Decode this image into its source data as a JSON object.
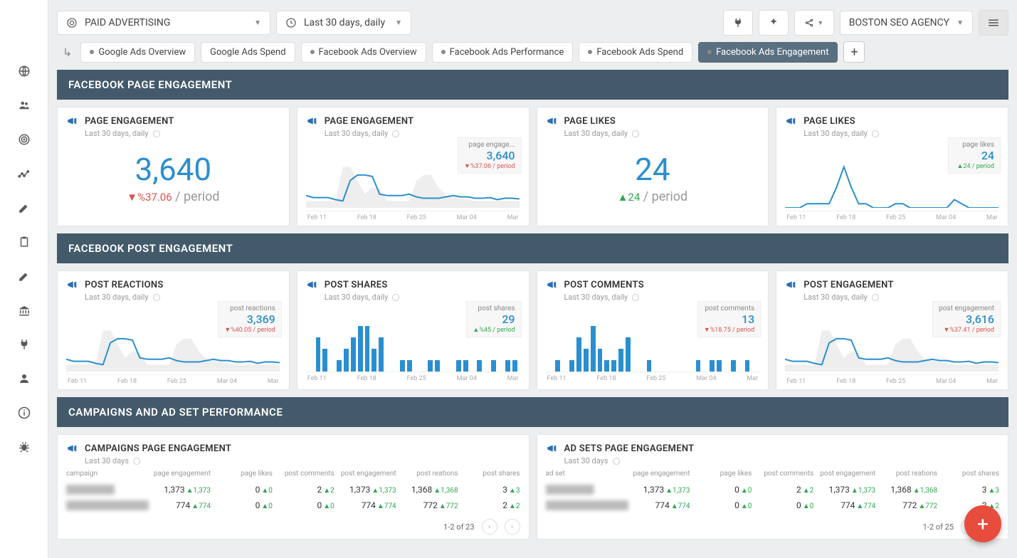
{
  "topbar": {
    "report_name": "PAID ADVERTISING",
    "date_range": "Last 30 days, daily",
    "client_name": "BOSTON SEO AGENCY"
  },
  "tabs": [
    {
      "label": "Google Ads Overview",
      "dot": true
    },
    {
      "label": "Google Ads Spend",
      "dot": false
    },
    {
      "label": "Facebook Ads Overview",
      "dot": true
    },
    {
      "label": "Facebook Ads Performance",
      "dot": true
    },
    {
      "label": "Facebook Ads Spend",
      "dot": true
    },
    {
      "label": "Facebook Ads Engagement",
      "dot": true,
      "active": true
    }
  ],
  "sections": {
    "s1": "FACEBOOK PAGE ENGAGEMENT",
    "s2": "FACEBOOK POST ENGAGEMENT",
    "s3": "CAMPAIGNS AND AD SET PERFORMANCE"
  },
  "xaxis": [
    "Feb 11",
    "Feb 18",
    "Feb 25",
    "Mar 04",
    "Mar"
  ],
  "page_engagement_big": {
    "title": "PAGE ENGAGEMENT",
    "sub": "Last 30 days, daily",
    "value": "3,640",
    "delta": "▼%37.06",
    "period": "/ period"
  },
  "page_engagement_chart": {
    "title": "PAGE ENGAGEMENT",
    "sub": "Last 30 days, daily",
    "box_label": "page engage...",
    "box_value": "3,640",
    "box_delta": "▼%37.06 / period"
  },
  "page_likes_big": {
    "title": "PAGE LIKES",
    "sub": "Last 30 days, daily",
    "value": "24",
    "delta": "▲24",
    "period": "/ period"
  },
  "page_likes_chart": {
    "title": "PAGE LIKES",
    "sub": "Last 30 days, daily",
    "box_label": "page likes",
    "box_value": "24",
    "box_delta": "▲24 / period"
  },
  "post_reactions": {
    "title": "POST REACTIONS",
    "sub": "Last 30 days, daily",
    "box_label": "post reactions",
    "box_value": "3,369",
    "box_delta": "▼%40.05 / period"
  },
  "post_shares": {
    "title": "POST SHARES",
    "sub": "Last 30 days, daily",
    "box_label": "post shares",
    "box_value": "29",
    "box_delta": "▲%45 / period"
  },
  "post_comments": {
    "title": "POST COMMENTS",
    "sub": "Last 30 days, daily",
    "box_label": "post comments",
    "box_value": "13",
    "box_delta": "▼%18.75 / period"
  },
  "post_engagement": {
    "title": "POST ENGAGEMENT",
    "sub": "Last 30 days, daily",
    "box_label": "post engagement",
    "box_value": "3,616",
    "box_delta": "▼%37.41 / period"
  },
  "chart_data": [
    {
      "id": "page_engagement_chart",
      "type": "line",
      "xlabel": "",
      "ylabel": "",
      "x_ticks": [
        "Feb 11",
        "Feb 18",
        "Feb 25",
        "Mar 04",
        "Mar"
      ],
      "series": [
        {
          "name": "current",
          "values": [
            18,
            15,
            15,
            15,
            12,
            10,
            40,
            48,
            48,
            46,
            20,
            18,
            18,
            18,
            20,
            16,
            14,
            14,
            14,
            16,
            18,
            16,
            16,
            14,
            14,
            15,
            12,
            14,
            14,
            13
          ]
        },
        {
          "name": "previous",
          "values": [
            10,
            10,
            10,
            10,
            10,
            60,
            60,
            40,
            20,
            30,
            28,
            10,
            10,
            10,
            10,
            40,
            48,
            48,
            30,
            18,
            16,
            14,
            12,
            10,
            10,
            10,
            10,
            10,
            10,
            10
          ]
        }
      ],
      "total": 3640
    },
    {
      "id": "page_likes_chart",
      "type": "line",
      "x_ticks": [
        "Feb 11",
        "Feb 18",
        "Feb 25",
        "Mar 04",
        "Mar"
      ],
      "series": [
        {
          "name": "current",
          "values": [
            0,
            0,
            0,
            1,
            1,
            1,
            1,
            5,
            10,
            5,
            1,
            1,
            0,
            0,
            0,
            1,
            1,
            0,
            0,
            0,
            0,
            0,
            0,
            2,
            1,
            0,
            0,
            0,
            0,
            0
          ]
        }
      ],
      "total": 24
    },
    {
      "id": "post_reactions",
      "type": "line",
      "x_ticks": [
        "Feb 11",
        "Feb 18",
        "Feb 25",
        "Mar 04",
        "Mar"
      ],
      "series": [
        {
          "name": "current",
          "values": [
            18,
            15,
            15,
            15,
            12,
            10,
            42,
            48,
            48,
            46,
            20,
            18,
            18,
            18,
            20,
            16,
            14,
            14,
            14,
            16,
            18,
            16,
            16,
            14,
            14,
            15,
            12,
            14,
            14,
            13
          ]
        },
        {
          "name": "previous",
          "values": [
            10,
            10,
            10,
            10,
            10,
            60,
            60,
            40,
            20,
            30,
            28,
            10,
            10,
            10,
            10,
            40,
            48,
            48,
            30,
            18,
            16,
            14,
            12,
            10,
            10,
            10,
            10,
            10,
            10,
            10
          ]
        }
      ],
      "total": 3369
    },
    {
      "id": "post_shares",
      "type": "bar",
      "x_ticks": [
        "Feb 11",
        "Feb 18",
        "Feb 25",
        "Mar 04",
        "Mar"
      ],
      "values": [
        0,
        3,
        2,
        0,
        1,
        2,
        3,
        4,
        4,
        2,
        3,
        0,
        0,
        1,
        1,
        0,
        0,
        1,
        1,
        0,
        0,
        1,
        1,
        0,
        1,
        0,
        1,
        0,
        1,
        1
      ],
      "total": 29
    },
    {
      "id": "post_comments",
      "type": "bar",
      "x_ticks": [
        "Feb 11",
        "Feb 18",
        "Feb 25",
        "Mar 04",
        "Mar"
      ],
      "values": [
        0,
        1,
        0,
        1,
        3,
        2,
        4,
        2,
        1,
        1,
        2,
        3,
        0,
        0,
        1,
        0,
        0,
        0,
        0,
        0,
        0,
        1,
        0,
        1,
        1,
        0,
        1,
        0,
        1,
        0
      ],
      "total": 13
    },
    {
      "id": "post_engagement",
      "type": "line",
      "x_ticks": [
        "Feb 11",
        "Feb 18",
        "Feb 25",
        "Mar 04",
        "Mar"
      ],
      "series": [
        {
          "name": "current",
          "values": [
            18,
            15,
            15,
            15,
            12,
            10,
            42,
            48,
            48,
            46,
            20,
            18,
            18,
            18,
            20,
            16,
            14,
            14,
            14,
            16,
            18,
            16,
            16,
            14,
            14,
            15,
            12,
            14,
            14,
            13
          ]
        },
        {
          "name": "previous",
          "values": [
            10,
            10,
            10,
            10,
            10,
            60,
            60,
            40,
            20,
            30,
            28,
            10,
            10,
            10,
            10,
            40,
            48,
            48,
            30,
            18,
            16,
            14,
            12,
            10,
            10,
            10,
            10,
            10,
            10,
            10
          ]
        }
      ],
      "total": 3616
    }
  ],
  "campaigns_table": {
    "title": "CAMPAIGNS PAGE ENGAGEMENT",
    "sub": "Last 30 days",
    "headers": [
      "campaign",
      "page engagement",
      "page likes",
      "post comments",
      "post engagement",
      "post reations",
      "post shares"
    ],
    "rows": [
      {
        "name": "████████",
        "cells": [
          {
            "v": "1,373",
            "d": "▲1,373"
          },
          {
            "v": "0",
            "d": "▲0"
          },
          {
            "v": "2",
            "d": "▲2"
          },
          {
            "v": "1,373",
            "d": "▲1,373"
          },
          {
            "v": "1,368",
            "d": "▲1,368"
          },
          {
            "v": "3",
            "d": "▲3"
          }
        ]
      },
      {
        "name": "██████████████",
        "cells": [
          {
            "v": "774",
            "d": "▲774"
          },
          {
            "v": "0",
            "d": "▲0"
          },
          {
            "v": "0",
            "d": "▲0"
          },
          {
            "v": "774",
            "d": "▲774"
          },
          {
            "v": "772",
            "d": "▲772"
          },
          {
            "v": "2",
            "d": "▲2"
          }
        ]
      }
    ],
    "pager": "1-2 of 23"
  },
  "adsets_table": {
    "title": "AD SETS PAGE ENGAGEMENT",
    "sub": "Last 30 days",
    "headers": [
      "ad set",
      "page engagement",
      "page likes",
      "post comments",
      "post engagement",
      "post reations",
      "post shares"
    ],
    "rows": [
      {
        "name": "████████",
        "cells": [
          {
            "v": "1,373",
            "d": "▲1,373"
          },
          {
            "v": "0",
            "d": "▲0"
          },
          {
            "v": "2",
            "d": "▲2"
          },
          {
            "v": "1,373",
            "d": "▲1,373"
          },
          {
            "v": "1,368",
            "d": "▲1,368"
          },
          {
            "v": "3",
            "d": "▲3"
          }
        ]
      },
      {
        "name": "██████████████",
        "cells": [
          {
            "v": "774",
            "d": "▲774"
          },
          {
            "v": "0",
            "d": "▲0"
          },
          {
            "v": "0",
            "d": "▲0"
          },
          {
            "v": "774",
            "d": "▲774"
          },
          {
            "v": "772",
            "d": "▲772"
          },
          {
            "v": "2",
            "d": "▲2"
          }
        ]
      }
    ],
    "pager": "1-2 of 25"
  }
}
